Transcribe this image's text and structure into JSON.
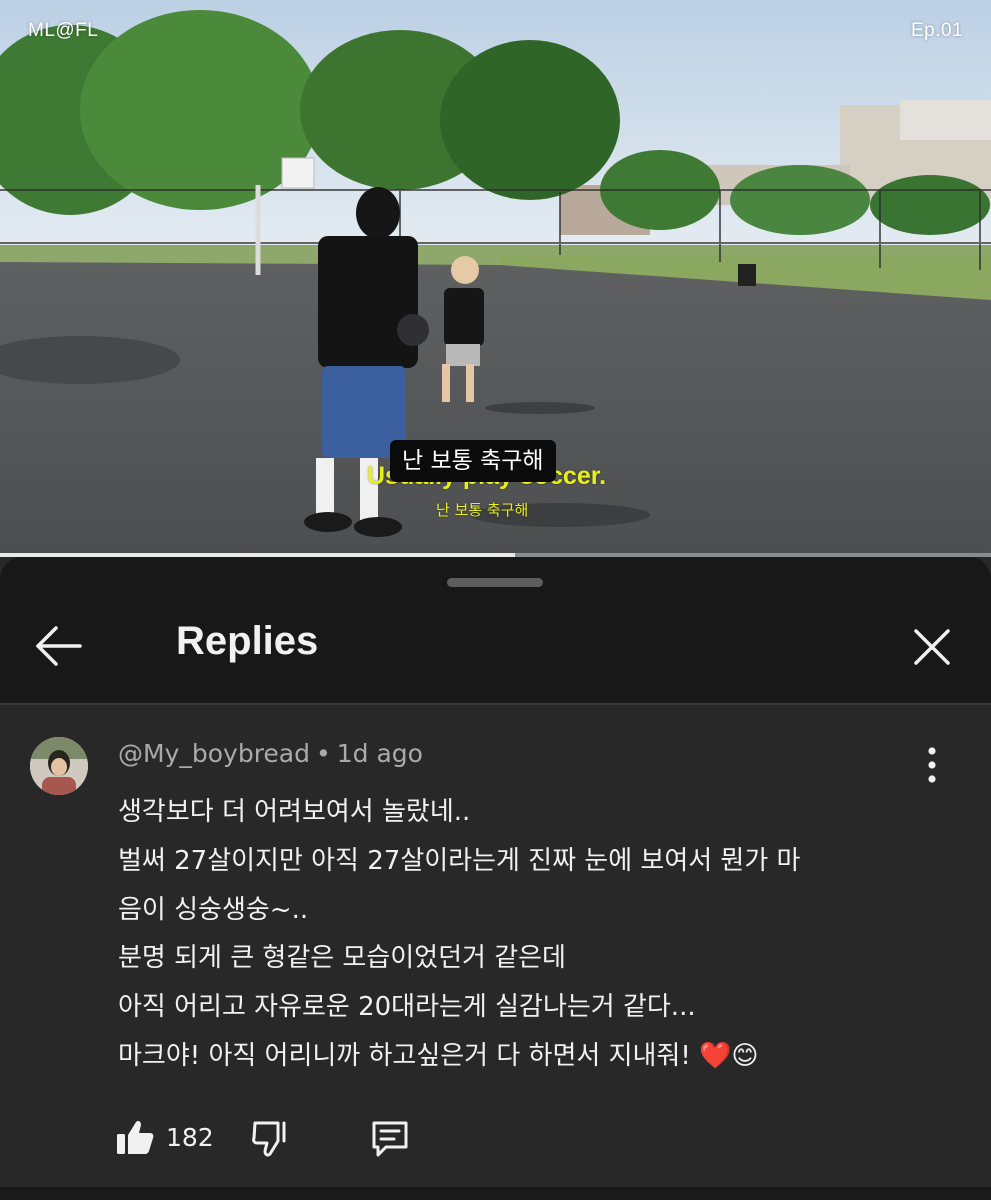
{
  "video": {
    "watermark_left": "ML@FL",
    "watermark_right": "Ep.01",
    "caption_box": "난 보통 축구해",
    "caption_en": "Usually play soccer.",
    "caption_ko": "난 보통 축구해",
    "progress_fraction": 0.52
  },
  "panel": {
    "title": "Replies",
    "back_icon": "arrow-left-icon",
    "close_icon": "close-icon"
  },
  "comment": {
    "author": "@My_boybread",
    "separator": "•",
    "time": "1d ago",
    "lines": [
      "생각보다 더 어려보여서 놀랐네..",
      "벌써 27살이지만 아직 27살이라는게 진짜 눈에 보여서 뭔가 마",
      "음이 싱숭생숭~..",
      "분명 되게 큰 형같은 모습이었던거 같은데",
      "아직 어리고 자유로운 20대라는게 실감나는거 같다...",
      "마크야! 아직 어리니까 하고싶은거 다 하면서 지내줘! ❤️😊"
    ],
    "like_count": "182",
    "like_icon": "thumb-up-icon",
    "dislike_icon": "thumb-down-icon",
    "reply_icon": "reply-icon",
    "menu_icon": "more-vert-icon"
  },
  "colors": {
    "panel_bg": "#282828",
    "header_bg": "#181818",
    "caption_yellow": "#e8f01a",
    "meta_gray": "#aaaaaa"
  }
}
